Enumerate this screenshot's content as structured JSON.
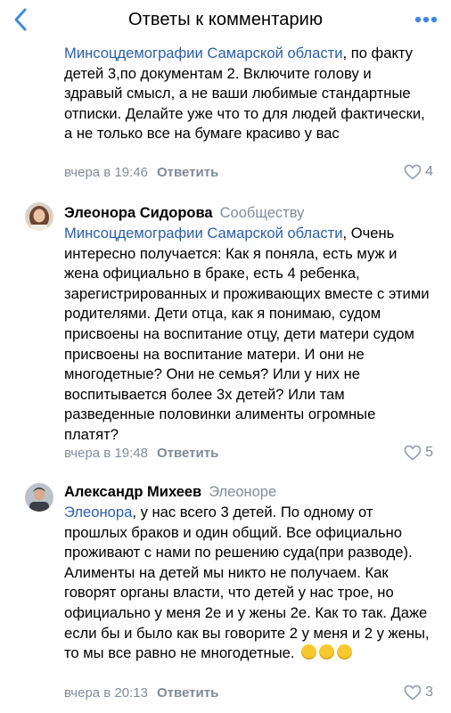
{
  "header": {
    "title": "Ответы к комментарию",
    "back_icon": "chevron-left-icon",
    "more_icon": "more-dots-icon"
  },
  "colors": {
    "accent": "#2a5ea8",
    "secondary": "#818c99",
    "icon": "#3f8ae0"
  },
  "comments": [
    {
      "mention": "Минсоцдемографии Самарской области",
      "text": ", по факту детей 3,по документам 2. Включите голову и здравый смысл, а не ваши любимые стандартные отписки. Делайте уже что то для людей фактически, а не только все на бумаге красиво у вас",
      "time": "вчера в 19:46",
      "reply_label": "Ответить",
      "likes": "4"
    },
    {
      "author": "Элеонора Сидорова",
      "target": "Сообществу",
      "mention": "Минсоцдемографии Самарской области",
      "text": ", Очень интересно получается: Как я поняла, есть муж и жена официально в браке, есть 4 ребенка, зарегистрированных и проживающих вместе с этими родителями. Дети отца, как я понимаю, судом присвоены на воспитание отцу, дети матери судом присвоены на воспитание матери. И они не многодетные? Они не семья? Или у них не воспитывается более 3х детей? Или там разведенные половинки алименты огромные платят?",
      "time": "вчера в 19:48",
      "reply_label": "Ответить",
      "likes": "5"
    },
    {
      "author": "Александр Михеев",
      "target": "Элеоноре",
      "mention": "Элеонора",
      "text": ", у нас всего 3 детей. По одному от прошлых браков и один общий. Все официально проживают с нами по решению суда(при разводе). Алименты на детей мы никто не получаем. Как говорят органы власти, что детей у нас трое, но официально у меня 2е и у жены 2е. Как то так. Даже если бы и было как вы говорите 2 у меня и 2 у жены, то мы все равно не многодетные.",
      "emoji": "rofl-emoji",
      "time": "вчера в 20:13",
      "reply_label": "Ответить",
      "likes": "3"
    }
  ]
}
